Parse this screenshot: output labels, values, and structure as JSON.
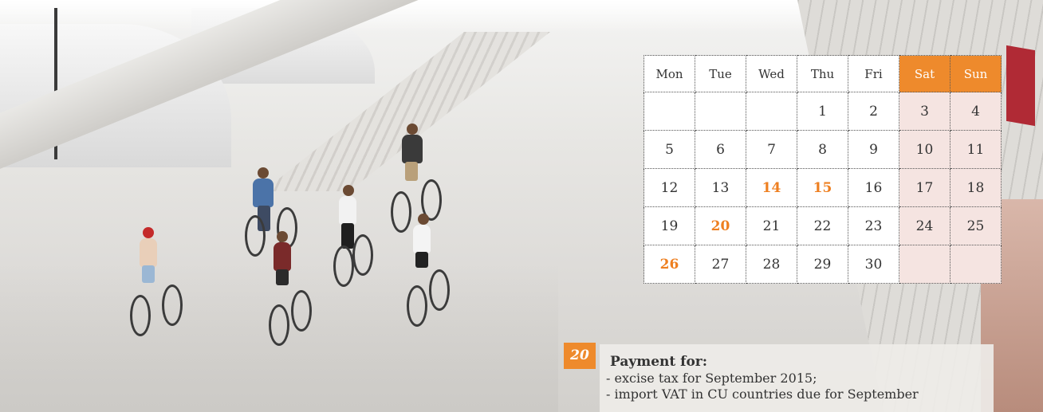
{
  "calendar": {
    "weekdays": [
      "Mon",
      "Tue",
      "Wed",
      "Thu",
      "Fri",
      "Sat",
      "Sun"
    ],
    "weeks": [
      [
        "",
        "",
        "",
        "1",
        "2",
        "3",
        "4"
      ],
      [
        "5",
        "6",
        "7",
        "8",
        "9",
        "10",
        "11"
      ],
      [
        "12",
        "13",
        "14",
        "15",
        "16",
        "17",
        "18"
      ],
      [
        "19",
        "20",
        "21",
        "22",
        "23",
        "24",
        "25"
      ],
      [
        "26",
        "27",
        "28",
        "29",
        "30",
        "",
        ""
      ]
    ],
    "highlighted_days": [
      "14",
      "15",
      "20",
      "26"
    ],
    "colors": {
      "accent": "#ee8a2c",
      "highlight_text": "#ee7f20",
      "weekend_cell": "#f5e4e1"
    }
  },
  "notice": {
    "day": "20",
    "title": "Payment for:",
    "items": [
      "- excise tax for September 2015;",
      "- import VAT in CU countries due for September"
    ]
  }
}
